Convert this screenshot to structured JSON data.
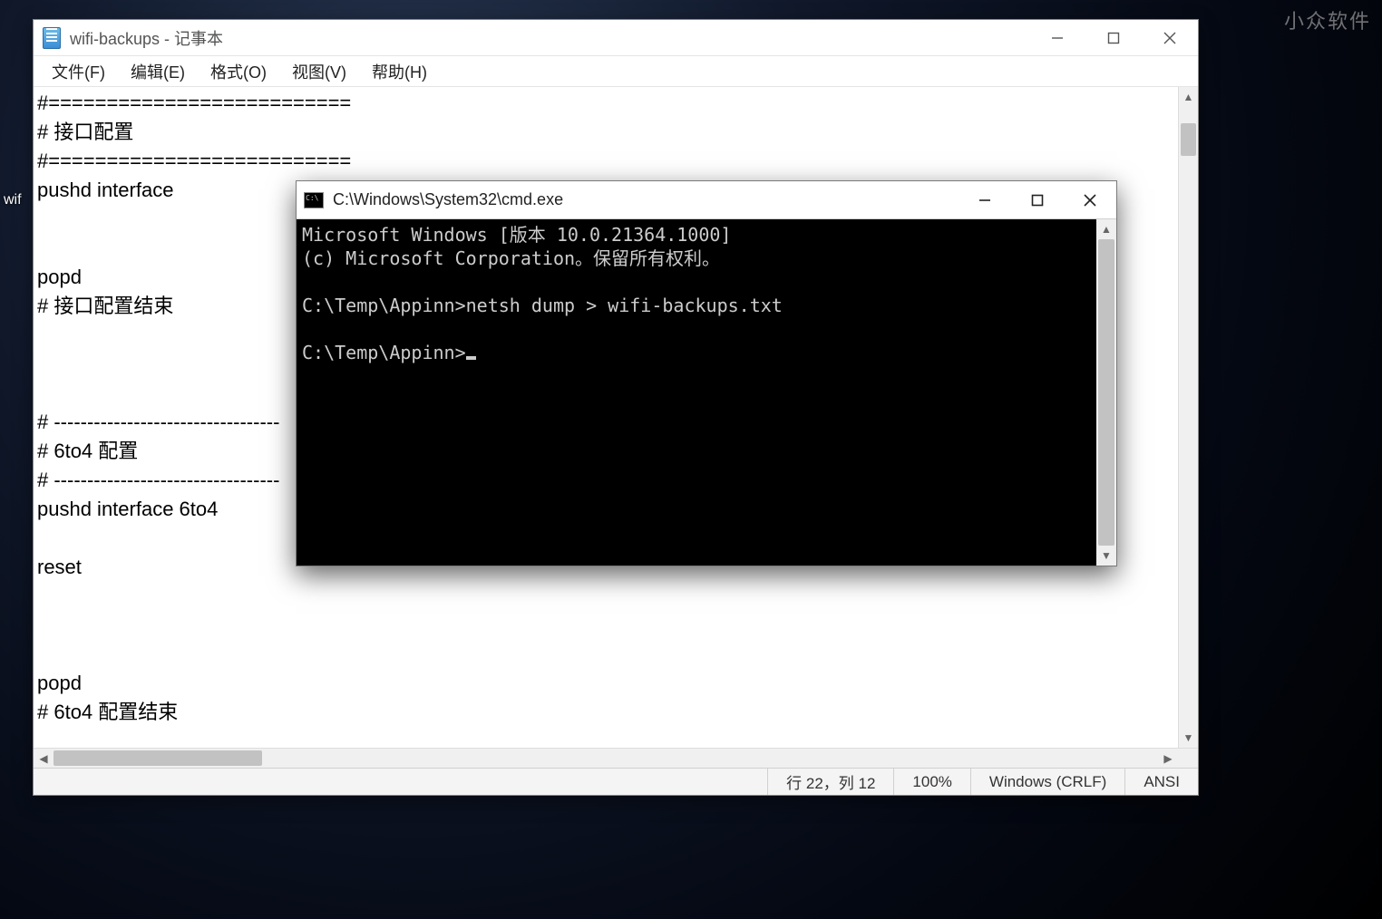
{
  "watermark": "小众软件",
  "desktop_icon_label": "wif",
  "notepad": {
    "title": "wifi-backups - 记事本",
    "menu": {
      "file": "文件(F)",
      "edit": "编辑(E)",
      "format": "格式(O)",
      "view": "视图(V)",
      "help": "帮助(H)"
    },
    "content": "#==========================\n# 接口配置\n#==========================\npushd interface\n\n\npopd\n# 接口配置结束\n\n\n\n# ----------------------------------\n# 6to4 配置\n# ----------------------------------\npushd interface 6to4\n\nreset\n\n\n\npopd\n# 6to4 配置结束\n",
    "status": {
      "position": "行 22，列 12",
      "zoom": "100%",
      "line_ending": "Windows (CRLF)",
      "encoding": "ANSI"
    }
  },
  "cmd": {
    "title": "C:\\Windows\\System32\\cmd.exe",
    "banner_line1": "Microsoft Windows [版本 10.0.21364.1000]",
    "banner_line2": "(c) Microsoft Corporation。保留所有权利。",
    "prompt1": "C:\\Temp\\Appinn>",
    "command1": "netsh dump > wifi-backups.txt",
    "prompt2": "C:\\Temp\\Appinn>"
  }
}
